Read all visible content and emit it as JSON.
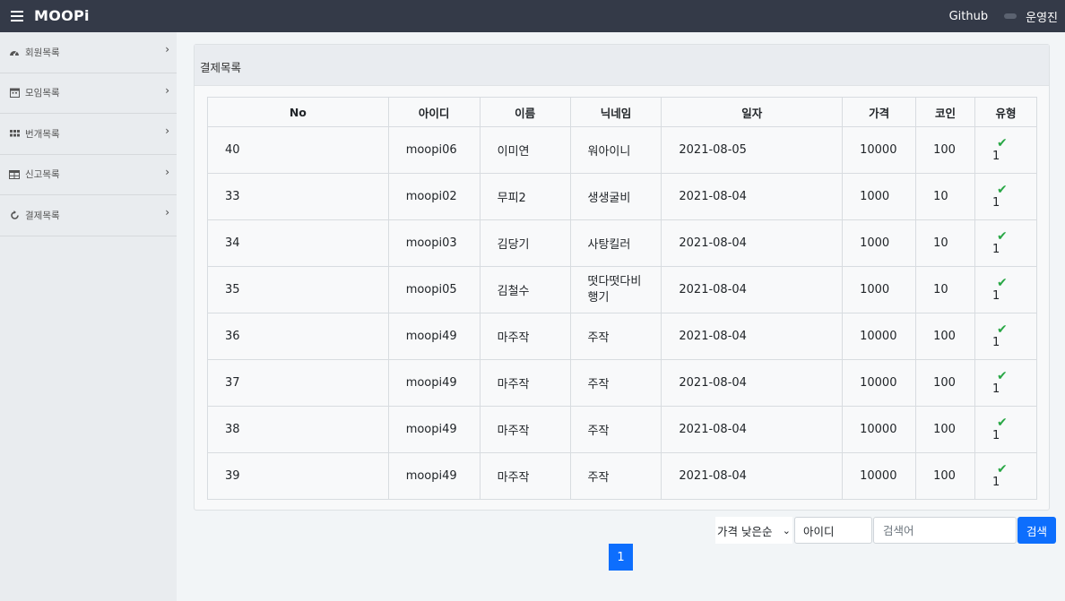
{
  "topbar": {
    "brand": "MOOPi",
    "github_label": "Github",
    "user_name": "운영진"
  },
  "sidebar": {
    "items": [
      {
        "label": "회원목록",
        "icon": "dashboard-icon"
      },
      {
        "label": "모임목록",
        "icon": "calendar-icon"
      },
      {
        "label": "번개목록",
        "icon": "grid-icon"
      },
      {
        "label": "신고목록",
        "icon": "table-icon"
      },
      {
        "label": "결제목록",
        "icon": "refresh-icon"
      }
    ]
  },
  "card": {
    "title": "결제목록"
  },
  "table": {
    "headers": [
      "No",
      "아이디",
      "이름",
      "닉네임",
      "일자",
      "가격",
      "코인",
      "유형"
    ],
    "rows": [
      {
        "no": "40",
        "id": "moopi06",
        "name": "이미연",
        "nickname": "워아이니",
        "date": "2021-08-05",
        "price": "10000",
        "coin": "100",
        "type": "1"
      },
      {
        "no": "33",
        "id": "moopi02",
        "name": "무피2",
        "nickname": "생생굴비",
        "date": "2021-08-04",
        "price": "1000",
        "coin": "10",
        "type": "1"
      },
      {
        "no": "34",
        "id": "moopi03",
        "name": "김당기",
        "nickname": "사탕킬러",
        "date": "2021-08-04",
        "price": "1000",
        "coin": "10",
        "type": "1"
      },
      {
        "no": "35",
        "id": "moopi05",
        "name": "김철수",
        "nickname": "떳다떳다비행기",
        "date": "2021-08-04",
        "price": "1000",
        "coin": "10",
        "type": "1"
      },
      {
        "no": "36",
        "id": "moopi49",
        "name": "마주작",
        "nickname": "주작",
        "date": "2021-08-04",
        "price": "10000",
        "coin": "100",
        "type": "1"
      },
      {
        "no": "37",
        "id": "moopi49",
        "name": "마주작",
        "nickname": "주작",
        "date": "2021-08-04",
        "price": "10000",
        "coin": "100",
        "type": "1"
      },
      {
        "no": "38",
        "id": "moopi49",
        "name": "마주작",
        "nickname": "주작",
        "date": "2021-08-04",
        "price": "10000",
        "coin": "100",
        "type": "1"
      },
      {
        "no": "39",
        "id": "moopi49",
        "name": "마주작",
        "nickname": "주작",
        "date": "2021-08-04",
        "price": "10000",
        "coin": "100",
        "type": "1"
      }
    ]
  },
  "search": {
    "sort_value": "가격 낮은순",
    "field_value": "아이디",
    "placeholder": "검색어",
    "button_label": "검색"
  },
  "pagination": {
    "current_page": "1"
  },
  "colors": {
    "topbar": "#343a48",
    "accent": "#0d6efd",
    "check": "#28a745"
  }
}
